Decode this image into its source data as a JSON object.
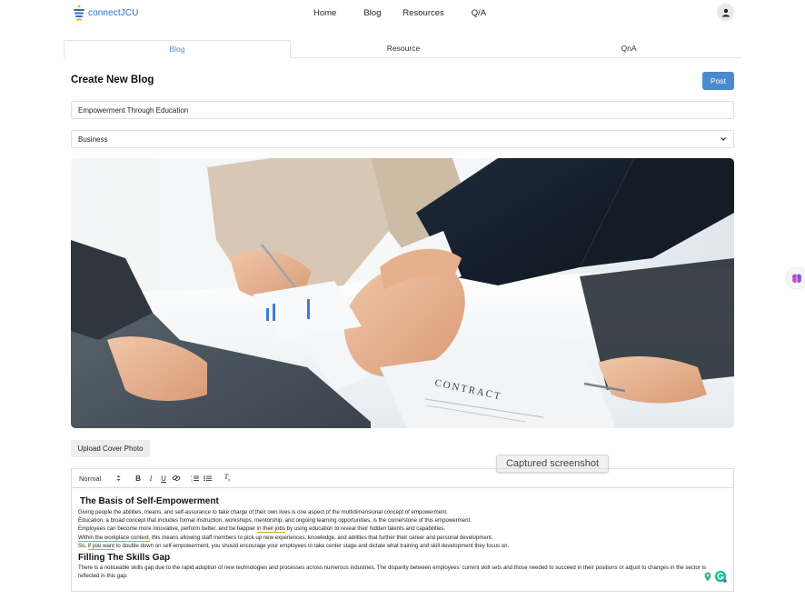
{
  "brand": {
    "name": "connectJCU"
  },
  "nav": {
    "items": [
      "Home",
      "Blog",
      "Resources",
      "Q/A"
    ]
  },
  "tabs": [
    "Blog",
    "Resource",
    "QnA"
  ],
  "form": {
    "heading": "Create New Blog",
    "post_label": "Post",
    "title_value": "Empowerment Through Education",
    "category_value": "Business",
    "upload_label": "Upload Cover Photo"
  },
  "cover_image": {
    "contract_text": "CONTRACT"
  },
  "tooltip": "Captured screenshot",
  "editor": {
    "format_value": "Normal",
    "toolbar_icons": [
      "bold-icon",
      "italic-icon",
      "underline-icon",
      "link-icon",
      "ordered-list-icon",
      "bullet-list-icon",
      "clear-format-icon"
    ],
    "heading1": "The Basis of Self-Empowerment",
    "lines": [
      "Giving people the abilities, means, and self-assurance to take charge of their own lives is one aspect of the multidimensional concept of empowerment.",
      "Education, a broad concept that includes formal instruction, workshops, mentorship, and ongoing learning opportunities, is the cornerstone of this empowerment."
    ],
    "line3_a": "Employees can become more innovative, perform better, and be happier ",
    "line3_flag": "in their jobs",
    "line3_b": " by using education to reveal their hidden talents and capabilities.",
    "line4_flag": "Within the workplace context,",
    "line4_b": " this means allowing staff members to pick up new experiences, knowledge, and abilities that further their career and personal development.",
    "line5_a": "So, ",
    "line5_flag": "if you want",
    "line5_b": " to double down on self-empowerment, you should encourage your employees to take center stage and dictate what training and skill development they focus on.",
    "heading2": "Filling The Skills Gap",
    "paragraph2": "There is a noticeable skills gap due to the rapid adoption of new technologies and processes across numerous industries. The disparity between employees' current skill sets and those needed to succeed in their positions or adjust to changes in the sector is reflected in this gap."
  },
  "colors": {
    "accent": "#4a8ad0",
    "brand": "#2a6fba",
    "flag": "#e0a13a"
  }
}
